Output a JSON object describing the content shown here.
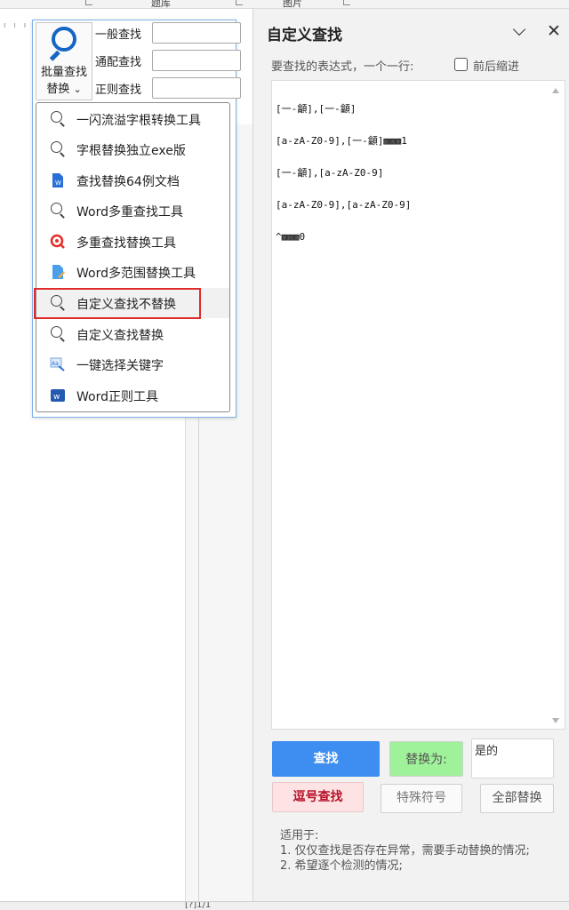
{
  "ribbon": {
    "group_labels": [
      "题库",
      "图片"
    ]
  },
  "find_group": {
    "batch_button": {
      "line1": "批量查找",
      "line2": "替换",
      "dropdown_arrow": "⌄"
    },
    "rows": [
      {
        "label": "一般查找",
        "value": ""
      },
      {
        "label": "通配查找",
        "value": ""
      },
      {
        "label": "正则查找",
        "value": ""
      }
    ]
  },
  "dropdown": {
    "items": [
      {
        "label": "一闪流溢字根转换工具",
        "icon": "search-icon"
      },
      {
        "label": "字根替换独立exe版",
        "icon": "search-icon"
      },
      {
        "label": "查找替换64例文档",
        "icon": "word-doc-icon"
      },
      {
        "label": "Word多重查找工具",
        "icon": "search-icon"
      },
      {
        "label": "多重查找替换工具",
        "icon": "red-search-icon"
      },
      {
        "label": "Word多范围替换工具",
        "icon": "file-edit-icon"
      },
      {
        "label": "自定义查找不替换",
        "icon": "search-icon"
      },
      {
        "label": "自定义查找替换",
        "icon": "search-icon"
      },
      {
        "label": "一键选择关键字",
        "icon": "keyword-select-icon"
      },
      {
        "label": "Word正则工具",
        "icon": "word-regex-icon"
      }
    ],
    "highlighted_index": 6
  },
  "pane": {
    "title": "自定义查找",
    "expr_label": "要查找的表达式，一个一行:",
    "fix_label": "前后缩进",
    "expr_lines": [
      "[一-龥],[一-龥]",
      "[a-zA-Z0-9],[一-龥]▩▩▩1",
      "[一-龥],[a-zA-Z0-9]",
      "[a-zA-Z0-9],[a-zA-Z0-9]",
      "^▩▩▩0"
    ],
    "find_label": "查找",
    "replace_as_label": "替换为:",
    "replace_value": "是的",
    "comma_find_label": "逗号查找",
    "special_label": "特殊符号",
    "replace_all_label": "全部替换",
    "applies_title": "适用于:",
    "applies_items": [
      "1. 仅仅查找是否存在异常，需要手动替换的情况;",
      "2. 希望逐个检测的情况;"
    ]
  },
  "status": {
    "text": "[?]1/1"
  },
  "colors": {
    "accent_blue": "#3d8ef0",
    "highlight_red": "#e02b2b",
    "replace_green": "#9ff29a",
    "comma_red": "#b8112a"
  }
}
